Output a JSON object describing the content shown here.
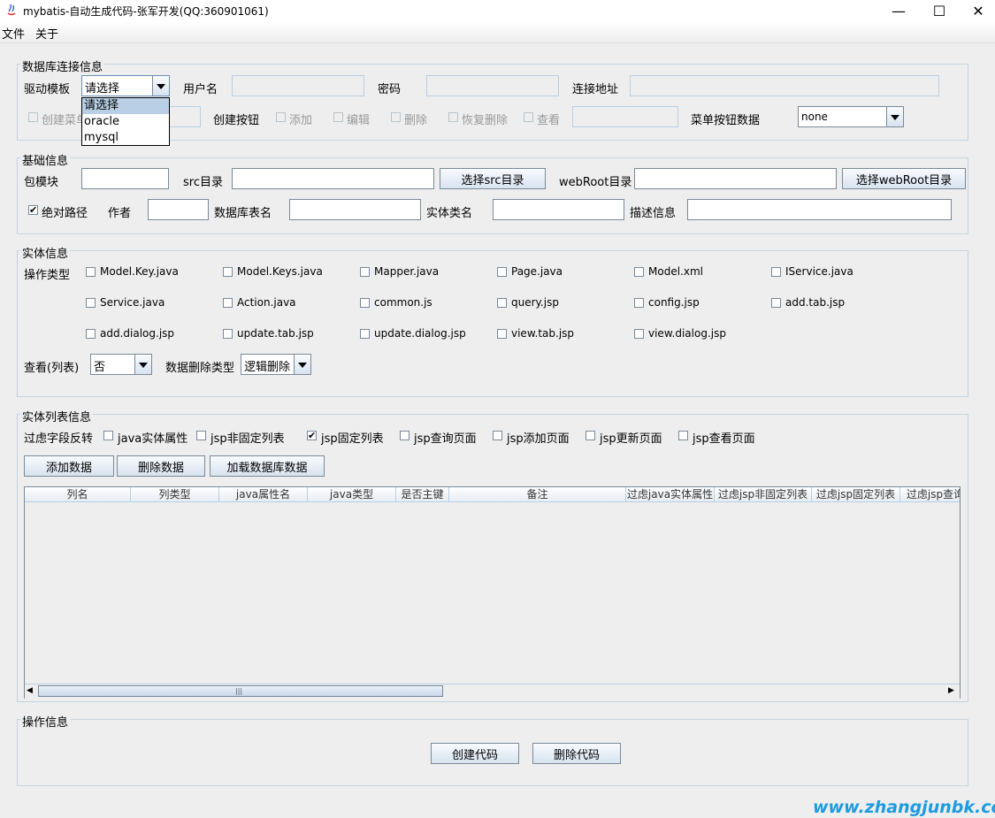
{
  "window": {
    "title": "mybatis-自动生成代码-张军开发(QQ:360901061)",
    "minimize": "—",
    "maximize": "☐",
    "close": "✕"
  },
  "menu": {
    "file": "文件",
    "about": "关于"
  },
  "db_section": {
    "title": "数据库连接信息",
    "driver_label": "驱动模板",
    "driver_value": "请选择",
    "driver_options": [
      "请选择",
      "oracle",
      "mysql"
    ],
    "username_label": "用户名",
    "password_label": "密码",
    "url_label": "连接地址",
    "create_menu_label": "创建菜单",
    "create_button_label": "创建按钮",
    "add_label": "添加",
    "edit_label": "编辑",
    "delete_label": "删除",
    "restore_label": "恢复删除",
    "view_label": "查看",
    "menu_button_data_label": "菜单按钮数据",
    "menu_button_data_value": "none"
  },
  "basic_section": {
    "title": "基础信息",
    "package_label": "包模块",
    "src_label": "src目录",
    "choose_src": "选择src目录",
    "webroot_label": "webRoot目录",
    "choose_webroot": "选择webRoot目录",
    "absolute_path_label": "绝对路径",
    "author_label": "作者",
    "table_name_label": "数据库表名",
    "entity_class_label": "实体类名",
    "description_label": "描述信息"
  },
  "entity_section": {
    "title": "实体信息",
    "op_type_label": "操作类型",
    "files": [
      "Model.Key.java",
      "Model.Keys.java",
      "Mapper.java",
      "Page.java",
      "Model.xml",
      "IService.java",
      "Service.java",
      "Action.java",
      "common.js",
      "query.jsp",
      "config.jsp",
      "add.tab.jsp",
      "add.dialog.jsp",
      "update.tab.jsp",
      "update.dialog.jsp",
      "view.tab.jsp",
      "view.dialog.jsp"
    ],
    "view_list_label": "查看(列表)",
    "view_list_value": "否",
    "delete_type_label": "数据删除类型",
    "delete_type_value": "逻辑删除"
  },
  "list_section": {
    "title": "实体列表信息",
    "filter_label": "过虑字段反转",
    "filters": [
      "java实体属性",
      "jsp非固定列表",
      "jsp固定列表",
      "jsp查询页面",
      "jsp添加页面",
      "jsp更新页面",
      "jsp查看页面"
    ],
    "add_data": "添加数据",
    "delete_data": "删除数据",
    "load_db_data": "加载数据库数据",
    "columns": [
      "列名",
      "列类型",
      "java属性名",
      "java类型",
      "是否主键",
      "备注",
      "过虑java实体属性",
      "过虑jsp非固定列表",
      "过虑jsp固定列表",
      "过虑jsp查询"
    ]
  },
  "ops_section": {
    "title": "操作信息",
    "create_code": "创建代码",
    "delete_code": "删除代码"
  },
  "watermark": "www.zhangjunbk.com"
}
